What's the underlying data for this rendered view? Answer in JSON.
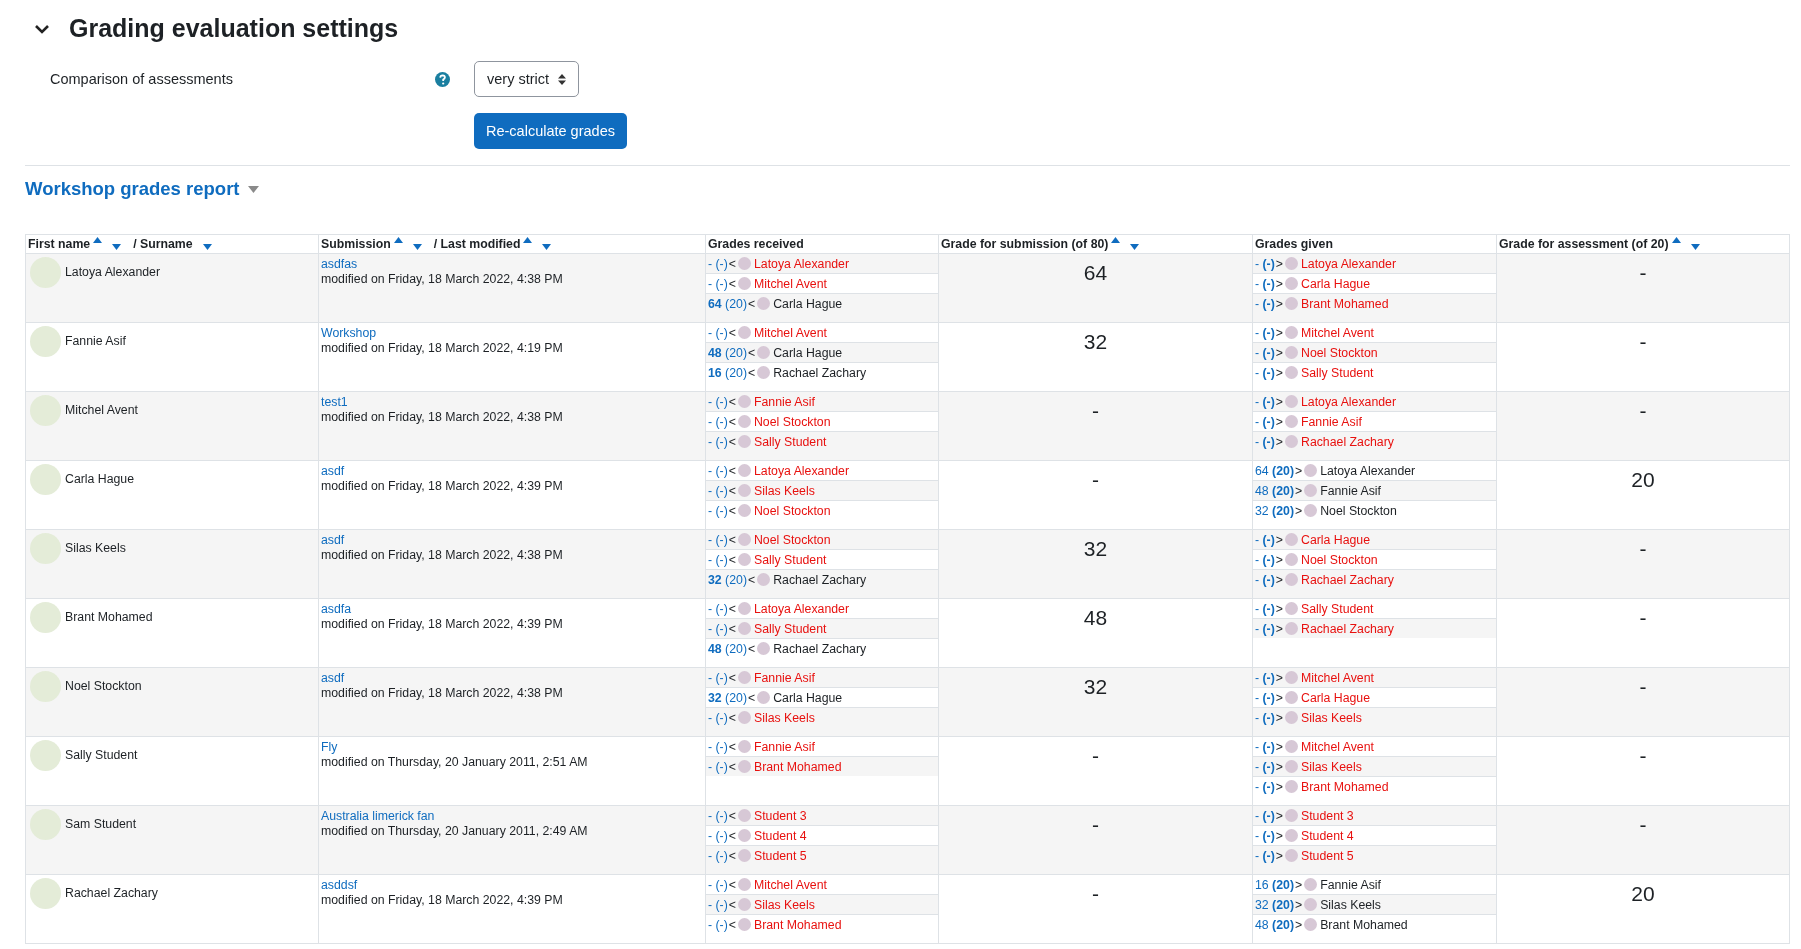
{
  "section": {
    "title": "Grading evaluation settings",
    "expanded": true,
    "field_label": "Comparison of assessments",
    "select_value": "very strict",
    "button": "Re-calculate grades"
  },
  "report": {
    "title": "Workshop grades report"
  },
  "table": {
    "columns": [
      {
        "parts": [
          {
            "label": "First name",
            "sort_up": true,
            "sort_down": true
          },
          {
            "label": "/ Surname",
            "sort_up": false,
            "sort_down": true
          }
        ]
      },
      {
        "parts": [
          {
            "label": "Submission",
            "sort_up": true,
            "sort_down": true
          },
          {
            "label": "/ Last modified",
            "sort_up": true,
            "sort_down": true
          }
        ]
      },
      {
        "parts": [
          {
            "label": "Grades received",
            "sort_up": false,
            "sort_down": false
          }
        ]
      },
      {
        "parts": [
          {
            "label": "Grade for submission (of 80)",
            "sort_up": true,
            "sort_down": true
          }
        ]
      },
      {
        "parts": [
          {
            "label": "Grades given",
            "sort_up": false,
            "sort_down": false
          }
        ]
      },
      {
        "parts": [
          {
            "label": "Grade for assessment (of 20)",
            "sort_up": true,
            "sort_down": true
          }
        ]
      }
    ],
    "rows": [
      {
        "name": "Latoya Alexander",
        "submission": "asdfas",
        "modified": "modified on Friday, 18 March 2022, 4:38 PM",
        "received": [
          {
            "score": "- (-)",
            "sep": "<",
            "name": "Latoya Alexander",
            "assessed": false
          },
          {
            "score": "- (-)",
            "sep": "<",
            "name": "Mitchel Avent",
            "assessed": false
          },
          {
            "score": "**64** (20)",
            "sep": "<",
            "name": "Carla Hague",
            "assessed": true
          }
        ],
        "submission_grade": "64",
        "given": [
          {
            "score": "- **(-)**",
            "sep": ">",
            "name": "Latoya Alexander",
            "assessed": false
          },
          {
            "score": "- **(-)**",
            "sep": ">",
            "name": "Carla Hague",
            "assessed": false
          },
          {
            "score": "- **(-)**",
            "sep": ">",
            "name": "Brant Mohamed",
            "assessed": false
          }
        ],
        "assessment_grade": "-"
      },
      {
        "name": "Fannie Asif",
        "submission": "Workshop",
        "modified": "modified on Friday, 18 March 2022, 4:19 PM",
        "received": [
          {
            "score": "- (-)",
            "sep": "<",
            "name": "Mitchel Avent",
            "assessed": false
          },
          {
            "score": "**48** (20)",
            "sep": "<",
            "name": "Carla Hague",
            "assessed": true
          },
          {
            "score": "**16** (20)",
            "sep": "<",
            "name": "Rachael Zachary",
            "assessed": true
          }
        ],
        "submission_grade": "32",
        "given": [
          {
            "score": "- **(-)**",
            "sep": ">",
            "name": "Mitchel Avent",
            "assessed": false
          },
          {
            "score": "- **(-)**",
            "sep": ">",
            "name": "Noel Stockton",
            "assessed": false
          },
          {
            "score": "- **(-)**",
            "sep": ">",
            "name": "Sally Student",
            "assessed": false
          }
        ],
        "assessment_grade": "-"
      },
      {
        "name": "Mitchel Avent",
        "submission": "test1",
        "modified": "modified on Friday, 18 March 2022, 4:38 PM",
        "received": [
          {
            "score": "- (-)",
            "sep": "<",
            "name": "Fannie Asif",
            "assessed": false
          },
          {
            "score": "- (-)",
            "sep": "<",
            "name": "Noel Stockton",
            "assessed": false
          },
          {
            "score": "- (-)",
            "sep": "<",
            "name": "Sally Student",
            "assessed": false
          }
        ],
        "submission_grade": "-",
        "given": [
          {
            "score": "- **(-)**",
            "sep": ">",
            "name": "Latoya Alexander",
            "assessed": false
          },
          {
            "score": "- **(-)**",
            "sep": ">",
            "name": "Fannie Asif",
            "assessed": false
          },
          {
            "score": "- **(-)**",
            "sep": ">",
            "name": "Rachael Zachary",
            "assessed": false
          }
        ],
        "assessment_grade": "-"
      },
      {
        "name": "Carla Hague",
        "submission": "asdf",
        "modified": "modified on Friday, 18 March 2022, 4:39 PM",
        "received": [
          {
            "score": "- (-)",
            "sep": "<",
            "name": "Latoya Alexander",
            "assessed": false
          },
          {
            "score": "- (-)",
            "sep": "<",
            "name": "Silas Keels",
            "assessed": false
          },
          {
            "score": "- (-)",
            "sep": "<",
            "name": "Noel Stockton",
            "assessed": false
          }
        ],
        "submission_grade": "-",
        "given": [
          {
            "score": "64 **(20)**",
            "sep": ">",
            "name": "Latoya Alexander",
            "assessed": true
          },
          {
            "score": "48 **(20)**",
            "sep": ">",
            "name": "Fannie Asif",
            "assessed": true
          },
          {
            "score": "32 **(20)**",
            "sep": ">",
            "name": "Noel Stockton",
            "assessed": true
          }
        ],
        "assessment_grade": "20"
      },
      {
        "name": "Silas Keels",
        "submission": "asdf",
        "modified": "modified on Friday, 18 March 2022, 4:38 PM",
        "received": [
          {
            "score": "- (-)",
            "sep": "<",
            "name": "Noel Stockton",
            "assessed": false
          },
          {
            "score": "- (-)",
            "sep": "<",
            "name": "Sally Student",
            "assessed": false
          },
          {
            "score": "**32** (20)",
            "sep": "<",
            "name": "Rachael Zachary",
            "assessed": true
          }
        ],
        "submission_grade": "32",
        "given": [
          {
            "score": "- **(-)**",
            "sep": ">",
            "name": "Carla Hague",
            "assessed": false
          },
          {
            "score": "- **(-)**",
            "sep": ">",
            "name": "Noel Stockton",
            "assessed": false
          },
          {
            "score": "- **(-)**",
            "sep": ">",
            "name": "Rachael Zachary",
            "assessed": false
          }
        ],
        "assessment_grade": "-"
      },
      {
        "name": "Brant Mohamed",
        "submission": "asdfa",
        "modified": "modified on Friday, 18 March 2022, 4:39 PM",
        "received": [
          {
            "score": "- (-)",
            "sep": "<",
            "name": "Latoya Alexander",
            "assessed": false
          },
          {
            "score": "- (-)",
            "sep": "<",
            "name": "Sally Student",
            "assessed": false
          },
          {
            "score": "**48** (20)",
            "sep": "<",
            "name": "Rachael Zachary",
            "assessed": true
          }
        ],
        "submission_grade": "48",
        "given": [
          {
            "score": "- **(-)**",
            "sep": ">",
            "name": "Sally Student",
            "assessed": false
          },
          {
            "score": "- **(-)**",
            "sep": ">",
            "name": "Rachael Zachary",
            "assessed": false
          }
        ],
        "assessment_grade": "-"
      },
      {
        "name": "Noel Stockton",
        "submission": "asdf",
        "modified": "modified on Friday, 18 March 2022, 4:38 PM",
        "received": [
          {
            "score": "- (-)",
            "sep": "<",
            "name": "Fannie Asif",
            "assessed": false
          },
          {
            "score": "**32** (20)",
            "sep": "<",
            "name": "Carla Hague",
            "assessed": true
          },
          {
            "score": "- (-)",
            "sep": "<",
            "name": "Silas Keels",
            "assessed": false
          }
        ],
        "submission_grade": "32",
        "given": [
          {
            "score": "- **(-)**",
            "sep": ">",
            "name": "Mitchel Avent",
            "assessed": false
          },
          {
            "score": "- **(-)**",
            "sep": ">",
            "name": "Carla Hague",
            "assessed": false
          },
          {
            "score": "- **(-)**",
            "sep": ">",
            "name": "Silas Keels",
            "assessed": false
          }
        ],
        "assessment_grade": "-"
      },
      {
        "name": "Sally Student",
        "submission": "Fly",
        "modified": "modified on Thursday, 20 January 2011, 2:51 AM",
        "received": [
          {
            "score": "- (-)",
            "sep": "<",
            "name": "Fannie Asif",
            "assessed": false
          },
          {
            "score": "- (-)",
            "sep": "<",
            "name": "Brant Mohamed",
            "assessed": false
          }
        ],
        "submission_grade": "-",
        "given": [
          {
            "score": "- **(-)**",
            "sep": ">",
            "name": "Mitchel Avent",
            "assessed": false
          },
          {
            "score": "- **(-)**",
            "sep": ">",
            "name": "Silas Keels",
            "assessed": false
          },
          {
            "score": "- **(-)**",
            "sep": ">",
            "name": "Brant Mohamed",
            "assessed": false
          }
        ],
        "assessment_grade": "-"
      },
      {
        "name": "Sam Student",
        "submission": "Australia limerick fan",
        "modified": "modified on Thursday, 20 January 2011, 2:49 AM",
        "received": [
          {
            "score": "- (-)",
            "sep": "<",
            "name": "Student 3",
            "assessed": false
          },
          {
            "score": "- (-)",
            "sep": "<",
            "name": "Student 4",
            "assessed": false
          },
          {
            "score": "- (-)",
            "sep": "<",
            "name": "Student 5",
            "assessed": false
          }
        ],
        "submission_grade": "-",
        "given": [
          {
            "score": "- **(-)**",
            "sep": ">",
            "name": "Student 3",
            "assessed": false
          },
          {
            "score": "- **(-)**",
            "sep": ">",
            "name": "Student 4",
            "assessed": false
          },
          {
            "score": "- **(-)**",
            "sep": ">",
            "name": "Student 5",
            "assessed": false
          }
        ],
        "assessment_grade": "-"
      },
      {
        "name": "Rachael Zachary",
        "submission": "asddsf",
        "modified": "modified on Friday, 18 March 2022, 4:39 PM",
        "received": [
          {
            "score": "- (-)",
            "sep": "<",
            "name": "Mitchel Avent",
            "assessed": false
          },
          {
            "score": "- (-)",
            "sep": "<",
            "name": "Silas Keels",
            "assessed": false
          },
          {
            "score": "- (-)",
            "sep": "<",
            "name": "Brant Mohamed",
            "assessed": false
          }
        ],
        "submission_grade": "-",
        "given": [
          {
            "score": "16 **(20)**",
            "sep": ">",
            "name": "Fannie Asif",
            "assessed": true
          },
          {
            "score": "32 **(20)**",
            "sep": ">",
            "name": "Silas Keels",
            "assessed": true
          },
          {
            "score": "48 **(20)**",
            "sep": ">",
            "name": "Brant Mohamed",
            "assessed": true
          }
        ],
        "assessment_grade": "20"
      }
    ]
  }
}
